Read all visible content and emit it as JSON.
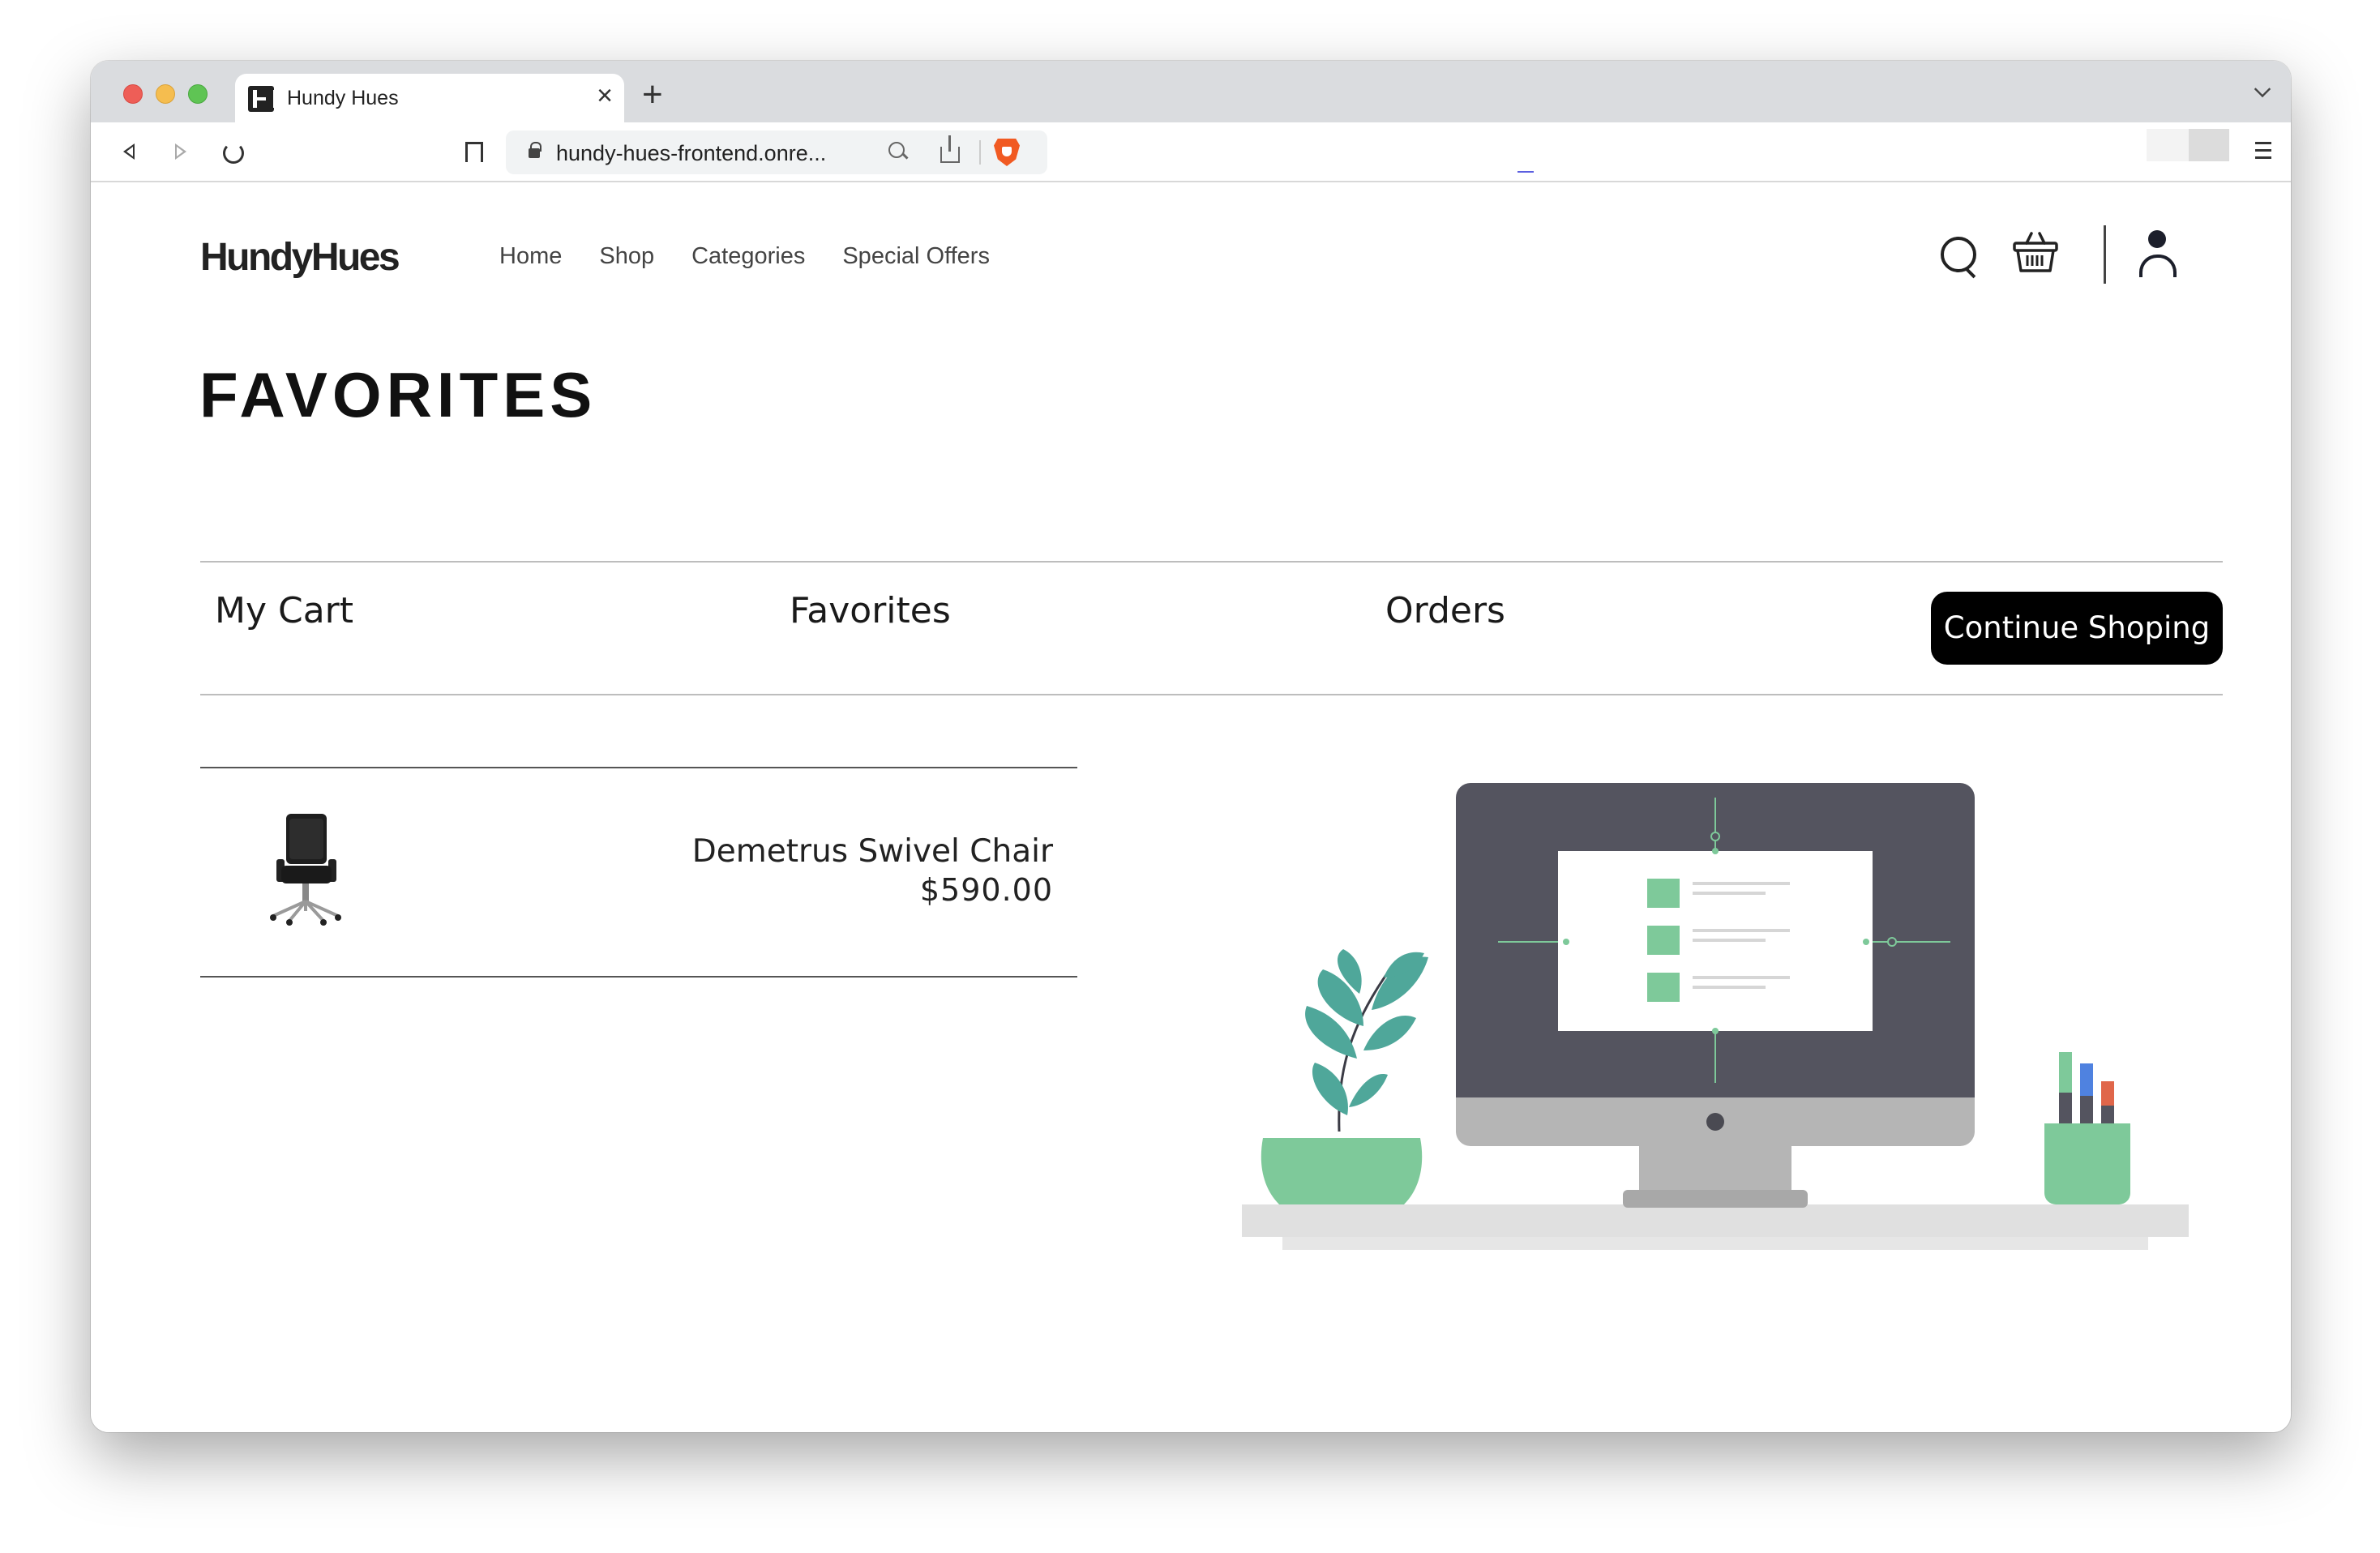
{
  "browser": {
    "tab_title": "Hundy Hues",
    "tab_close": "×",
    "new_tab": "+",
    "url": "hundy-hues-frontend.onre..."
  },
  "site": {
    "logo": "HundyHues",
    "nav": [
      "Home",
      "Shop",
      "Categories",
      "Special Offers"
    ]
  },
  "page": {
    "title": "FAVORITES"
  },
  "account_tabs": {
    "cart": "My Cart",
    "favorites": "Favorites",
    "orders": "Orders",
    "continue_button": "Continue Shoping"
  },
  "favorites": [
    {
      "name": "Demetrus Swivel Chair",
      "price": "$590.00",
      "image": "office-chair"
    }
  ],
  "colors": {
    "accent_green": "#7ec99a",
    "monitor_dark": "#54545f",
    "button_black": "#000000",
    "brave_orange": "#f15a22"
  }
}
